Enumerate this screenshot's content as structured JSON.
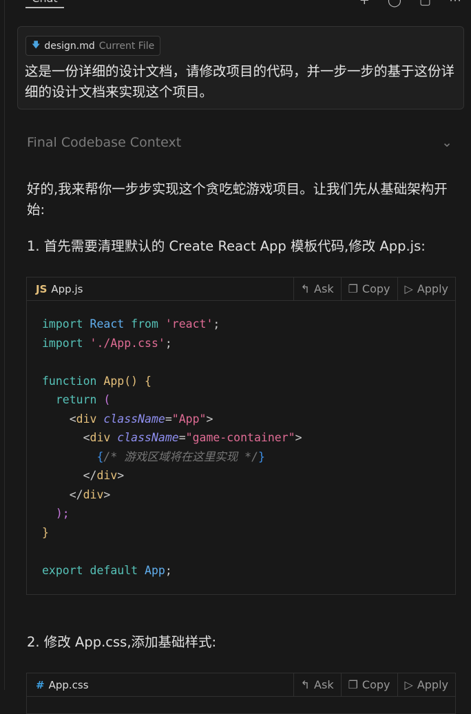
{
  "header": {
    "tab": "Chat",
    "icons": [
      "plus-icon",
      "history-icon",
      "maximize-icon",
      "more-icon"
    ]
  },
  "message": {
    "file_chip": {
      "icon": "markdown-icon",
      "name": "design.md",
      "tag": "Current File"
    },
    "text": "这是一份详细的设计文档，请修改项目的代码，并一步一步的基于这份详细的设计文档来实现这个项目。"
  },
  "context": {
    "label": "Final Codebase Context"
  },
  "response": {
    "intro": "好的,我来帮你一步步实现这个贪吃蛇游戏项目。让我们先从基础架构开始:",
    "step1": "1. 首先需要清理默认的 Create React App 模板代码,修改 App.js:",
    "step2": "2. 修改 App.css,添加基础样式:"
  },
  "code_blocks": [
    {
      "lang": "JS",
      "file": "App.js",
      "ask": "Ask",
      "copy": "Copy",
      "apply": "Apply",
      "lines": [
        [
          [
            "import",
            "kw"
          ],
          [
            " ",
            "pu"
          ],
          [
            "React",
            "id"
          ],
          [
            " ",
            "pu"
          ],
          [
            "from",
            "kw"
          ],
          [
            " ",
            "pu"
          ],
          [
            "'react'",
            "str"
          ],
          [
            ";",
            "pu"
          ]
        ],
        [
          [
            "import",
            "kw"
          ],
          [
            " ",
            "pu"
          ],
          [
            "'./App.css'",
            "str"
          ],
          [
            ";",
            "pu"
          ]
        ],
        [],
        [
          [
            "function",
            "kw"
          ],
          [
            " ",
            "pu"
          ],
          [
            "App",
            "fnm"
          ],
          [
            "()",
            "b1"
          ],
          [
            " ",
            "pu"
          ],
          [
            "{",
            "b1"
          ]
        ],
        [
          [
            "  return",
            "kw"
          ],
          [
            " ",
            "pu"
          ],
          [
            "(",
            "b2"
          ]
        ],
        [
          [
            "    <",
            "pu"
          ],
          [
            "div",
            "tag"
          ],
          [
            " ",
            "pu"
          ],
          [
            "className",
            "attr"
          ],
          [
            "=",
            "pu"
          ],
          [
            "\"App\"",
            "str"
          ],
          [
            ">",
            "pu"
          ]
        ],
        [
          [
            "      <",
            "pu"
          ],
          [
            "div",
            "tag"
          ],
          [
            " ",
            "pu"
          ],
          [
            "className",
            "attr"
          ],
          [
            "=",
            "pu"
          ],
          [
            "\"game-container\"",
            "str"
          ],
          [
            ">",
            "pu"
          ]
        ],
        [
          [
            "        {",
            "b3"
          ],
          [
            "/* 游戏区域将在这里实现 */",
            "cm"
          ],
          [
            "}",
            "b3"
          ]
        ],
        [
          [
            "      </",
            "pu"
          ],
          [
            "div",
            "tag"
          ],
          [
            ">",
            "pu"
          ]
        ],
        [
          [
            "    </",
            "pu"
          ],
          [
            "div",
            "tag"
          ],
          [
            ">",
            "pu"
          ]
        ],
        [
          [
            "  );",
            "b2"
          ]
        ],
        [
          [
            "}",
            "b1"
          ]
        ],
        [],
        [
          [
            "export",
            "kw"
          ],
          [
            " ",
            "pu"
          ],
          [
            "default",
            "kw"
          ],
          [
            " ",
            "pu"
          ],
          [
            "App",
            "id"
          ],
          [
            ";",
            "pu"
          ]
        ]
      ]
    },
    {
      "lang": "#",
      "file": "App.css",
      "ask": "Ask",
      "copy": "Copy",
      "apply": "Apply",
      "lines": []
    }
  ]
}
